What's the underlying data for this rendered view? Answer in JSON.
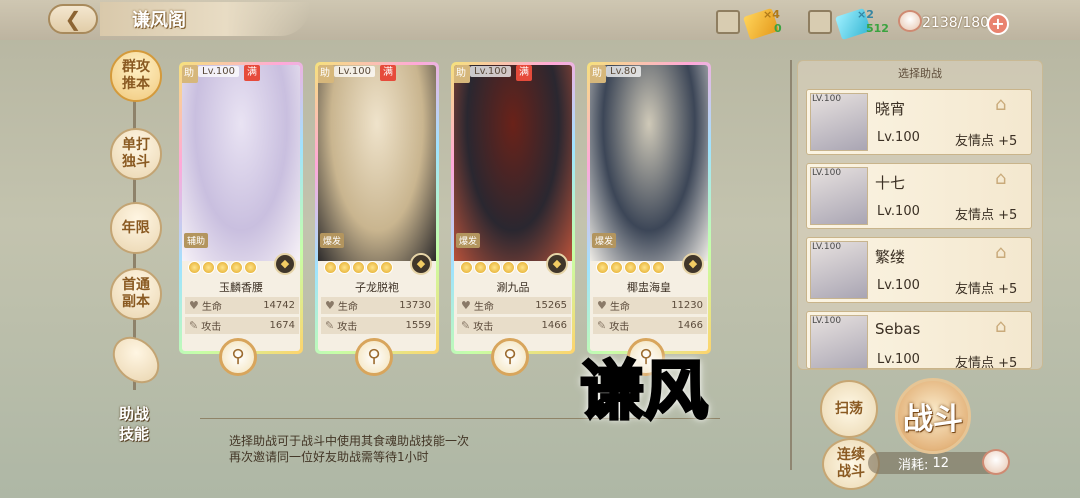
{
  "header": {
    "title": "谦风阁"
  },
  "resources": {
    "ticket1_count": "×4",
    "ticket1_value": "0",
    "ticket2_count": "×2",
    "ticket2_value": "512",
    "stamina": "2138/180"
  },
  "left_tabs": [
    "群攻推本",
    "单打独斗",
    "年限",
    "首通副本"
  ],
  "cards": [
    {
      "assist": "助",
      "level": "Lv.100",
      "full": "满",
      "role": "辅助",
      "name": "玉麟香腰",
      "hp_label": "生命",
      "hp": "14742",
      "atk_label": "攻击",
      "atk": "1674",
      "colors": [
        "#e9e3f3",
        "#c9bfdf",
        "#f7f2f7"
      ]
    },
    {
      "assist": "助",
      "level": "Lv.100",
      "full": "满",
      "role": "爆发",
      "name": "子龙脱袍",
      "hp_label": "生命",
      "hp": "13730",
      "atk_label": "攻击",
      "atk": "1559",
      "colors": [
        "#efe3cb",
        "#c9b58f",
        "#2c2a2b"
      ]
    },
    {
      "assist": "助",
      "level": "Lv.100",
      "full": "满",
      "role": "爆发",
      "name": "涮九品",
      "hp_label": "生命",
      "hp": "15265",
      "atk_label": "攻击",
      "atk": "1466",
      "colors": [
        "#6a2219",
        "#2a2730",
        "#b9523a"
      ]
    },
    {
      "assist": "助",
      "level": "Lv.80",
      "full": "",
      "role": "爆发",
      "name": "椰盅海皇",
      "hp_label": "生命",
      "hp": "11230",
      "atk_label": "攻击",
      "atk": "1466",
      "colors": [
        "#cfc9b8",
        "#3c4657",
        "#efece6"
      ]
    }
  ],
  "friend_panel": {
    "title": "选择助战",
    "friends": [
      {
        "avatar_level": "LV.100",
        "name": "晓宵",
        "level": "Lv.100",
        "points": "友情点 +5"
      },
      {
        "avatar_level": "LV.100",
        "name": "十七",
        "level": "Lv.100",
        "points": "友情点 +5"
      },
      {
        "avatar_level": "LV.100",
        "name": "繁缕",
        "level": "Lv.100",
        "points": "友情点 +5"
      },
      {
        "avatar_level": "LV.100",
        "name": "Sebas",
        "level": "Lv.100",
        "points": "友情点 +5"
      }
    ]
  },
  "actions": {
    "sweep": "扫荡",
    "continuous": "连续战斗",
    "battle": "战斗",
    "cost_label": "消耗:",
    "cost_value": "12"
  },
  "skill": {
    "label": "助战技能",
    "line1": "选择助战可于战斗中使用其食魂助战技能一次",
    "line2": "再次邀请同一位好友助战需等待1小时"
  },
  "watermark": "谦风"
}
